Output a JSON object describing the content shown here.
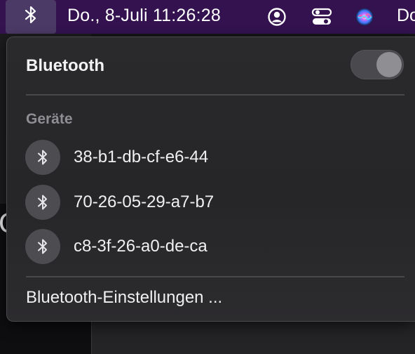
{
  "menubar": {
    "clock": "Do., 8-Juli 11:26:28",
    "truncated_item": "Do",
    "icons": [
      "bluetooth-icon",
      "user-icon",
      "control-center-icon",
      "siri-icon"
    ]
  },
  "background": {
    "visible_char": "C"
  },
  "popover": {
    "title": "Bluetooth",
    "toggle_state": "off",
    "section_label": "Geräte",
    "devices": [
      {
        "label": "38-b1-db-cf-e6-44",
        "icon": "bluetooth-icon"
      },
      {
        "label": "70-26-05-29-a7-b7",
        "icon": "bluetooth-icon"
      },
      {
        "label": "c8-3f-26-a0-de-ca",
        "icon": "bluetooth-icon"
      }
    ],
    "settings_label": "Bluetooth-Einstellungen ..."
  },
  "colors": {
    "menubar": "#34124f",
    "popover": "#2a2a2d",
    "text": "#f0f0f2",
    "secondary_text": "#8e8e93"
  }
}
